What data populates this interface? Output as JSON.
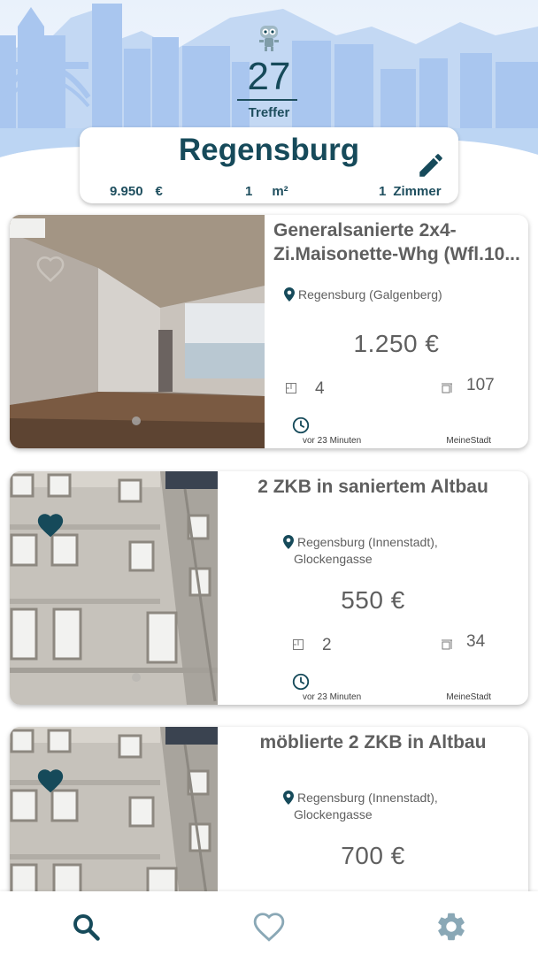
{
  "header": {
    "count": "27",
    "count_label": "Treffer"
  },
  "search": {
    "city": "Regensburg",
    "price": "9.950",
    "price_unit": "€",
    "size": "1",
    "size_unit": "m²",
    "rooms": "1",
    "rooms_unit": "Zimmer"
  },
  "listings": [
    {
      "title_line1": "Generalsanierte 2x4-",
      "title_line2": "Zi.Maisonette-Whg (Wfl.10...",
      "location_line1": "Regensburg (Galgenberg)",
      "location_line2": "",
      "price": "1.250  €",
      "rooms": "4",
      "area": "107",
      "time": "vor 23 Minuten",
      "source": "MeineStadt",
      "favorite": false
    },
    {
      "title_line1": "2 ZKB in saniertem Altbau",
      "location_line1": "Regensburg (Innenstadt),",
      "location_line2": "Glockengasse",
      "price": "550  €",
      "rooms": "2",
      "area": "34",
      "time": "vor 23 Minuten",
      "source": "MeineStadt",
      "favorite": true
    },
    {
      "title_line1": "möblierte 2 ZKB in Altbau",
      "location_line1": "Regensburg (Innenstadt),",
      "location_line2": "Glockengasse",
      "price": "700  €",
      "favorite": true
    }
  ],
  "nav": {
    "active": "search",
    "items": [
      "search-icon",
      "heart-icon",
      "gear-icon"
    ]
  },
  "colors": {
    "accent": "#164a5a",
    "sky": "#cfe0f5",
    "skyline": "#a9c7ee",
    "nav_active": "#164a5a",
    "nav_inactive": "#8aa8b6"
  }
}
